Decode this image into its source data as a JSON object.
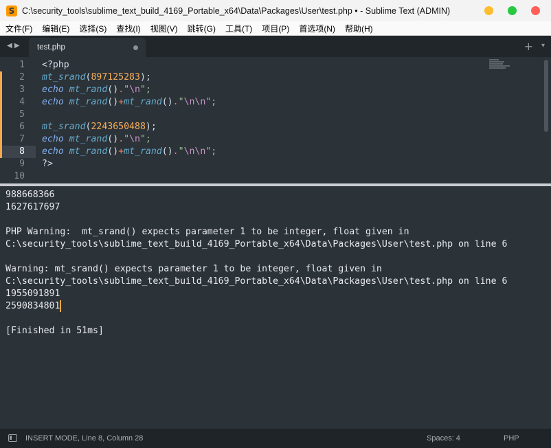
{
  "window": {
    "title": "C:\\security_tools\\sublime_text_build_4169_Portable_x64\\Data\\Packages\\User\\test.php • - Sublime Text (ADMIN)",
    "app_icon": "S"
  },
  "menu": [
    "文件(F)",
    "编辑(E)",
    "选择(S)",
    "查找(I)",
    "视图(V)",
    "跳转(G)",
    "工具(T)",
    "项目(P)",
    "首选项(N)",
    "帮助(H)"
  ],
  "tabs": {
    "nav_arrows": "◀ ▶",
    "active": {
      "label": "test.php",
      "dirty": true
    },
    "plus": "+",
    "chevron": "▾"
  },
  "editor": {
    "current_line": 8,
    "lines": [
      {
        "n": "1",
        "modified": false,
        "tokens": [
          {
            "t": "<?php",
            "c": "tag"
          }
        ]
      },
      {
        "n": "2",
        "modified": true,
        "tokens": [
          {
            "t": "mt_srand",
            "c": "fn"
          },
          {
            "t": "(",
            "c": "plain"
          },
          {
            "t": "897125283",
            "c": "num"
          },
          {
            "t": ");",
            "c": "plain"
          }
        ]
      },
      {
        "n": "3",
        "modified": true,
        "tokens": [
          {
            "t": "echo",
            "c": "kw"
          },
          {
            "t": " ",
            "c": "plain"
          },
          {
            "t": "mt_rand",
            "c": "fn"
          },
          {
            "t": "()",
            "c": "plain"
          },
          {
            "t": ".",
            "c": "op"
          },
          {
            "t": "\"",
            "c": "str"
          },
          {
            "t": "\\n",
            "c": "esc"
          },
          {
            "t": "\";",
            "c": "str"
          }
        ]
      },
      {
        "n": "4",
        "modified": true,
        "tokens": [
          {
            "t": "echo",
            "c": "kw"
          },
          {
            "t": " ",
            "c": "plain"
          },
          {
            "t": "mt_rand",
            "c": "fn"
          },
          {
            "t": "()",
            "c": "plain"
          },
          {
            "t": "+",
            "c": "op"
          },
          {
            "t": "mt_rand",
            "c": "fn"
          },
          {
            "t": "()",
            "c": "plain"
          },
          {
            "t": ".",
            "c": "op"
          },
          {
            "t": "\"",
            "c": "str"
          },
          {
            "t": "\\n\\n",
            "c": "esc"
          },
          {
            "t": "\";",
            "c": "str"
          }
        ]
      },
      {
        "n": "5",
        "modified": true,
        "tokens": []
      },
      {
        "n": "6",
        "modified": true,
        "tokens": [
          {
            "t": "mt_srand",
            "c": "fn"
          },
          {
            "t": "(",
            "c": "plain"
          },
          {
            "t": "2243650488",
            "c": "num"
          },
          {
            "t": ");",
            "c": "plain"
          }
        ]
      },
      {
        "n": "7",
        "modified": true,
        "tokens": [
          {
            "t": "echo",
            "c": "kw"
          },
          {
            "t": " ",
            "c": "plain"
          },
          {
            "t": "mt_rand",
            "c": "fn"
          },
          {
            "t": "()",
            "c": "plain"
          },
          {
            "t": ".",
            "c": "op"
          },
          {
            "t": "\"",
            "c": "str"
          },
          {
            "t": "\\n",
            "c": "esc"
          },
          {
            "t": "\";",
            "c": "str"
          }
        ]
      },
      {
        "n": "8",
        "modified": true,
        "tokens": [
          {
            "t": "echo",
            "c": "kw"
          },
          {
            "t": " ",
            "c": "plain"
          },
          {
            "t": "mt_rand",
            "c": "fn"
          },
          {
            "t": "()",
            "c": "plain"
          },
          {
            "t": "+",
            "c": "op"
          },
          {
            "t": "mt_rand",
            "c": "fn"
          },
          {
            "t": "()",
            "c": "plain"
          },
          {
            "t": ".",
            "c": "op"
          },
          {
            "t": "\"",
            "c": "str"
          },
          {
            "t": "\\n\\n",
            "c": "esc"
          },
          {
            "t": "\";",
            "c": "str"
          }
        ]
      },
      {
        "n": "9",
        "modified": false,
        "tokens": [
          {
            "t": "?>",
            "c": "tag"
          }
        ]
      },
      {
        "n": "10",
        "modified": false,
        "tokens": []
      }
    ]
  },
  "output": {
    "lines": [
      "988668366",
      "1627617697",
      "",
      "PHP Warning:  mt_srand() expects parameter 1 to be integer, float given in",
      "C:\\security_tools\\sublime_text_build_4169_Portable_x64\\Data\\Packages\\User\\test.php on line 6",
      "",
      "Warning: mt_srand() expects parameter 1 to be integer, float given in",
      "C:\\security_tools\\sublime_text_build_4169_Portable_x64\\Data\\Packages\\User\\test.php on line 6",
      "1955091891",
      "2590834801",
      "",
      "[Finished in 51ms]"
    ],
    "caret_line": 9
  },
  "status": {
    "mode": "INSERT MODE, Line 8, Column 28",
    "indent": "Spaces: 4",
    "syntax": "PHP"
  },
  "colors": {
    "accent": "#f7a84a",
    "background": "#2b3238"
  }
}
